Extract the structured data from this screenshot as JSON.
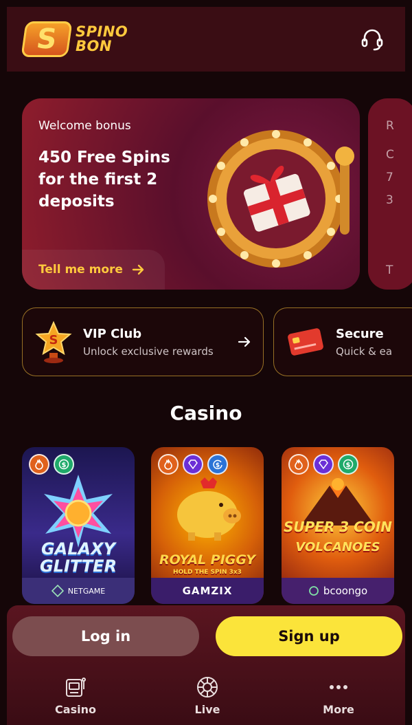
{
  "header": {
    "logo_mark": "S",
    "logo_text_line1": "SPINO",
    "logo_text_line2": "BON",
    "support_icon": "headset-icon"
  },
  "promo": {
    "eyebrow": "Welcome bonus",
    "headline": "450 Free Spins for the first 2 deposits",
    "cta_label": "Tell me more",
    "peek_letters": [
      "R",
      "C",
      "7",
      "3",
      "T"
    ]
  },
  "features": [
    {
      "title": "VIP Club",
      "subtitle": "Unlock exclusive rewards",
      "icon": "vip-trophy-icon"
    },
    {
      "title": "Secure",
      "subtitle": "Quick & ea",
      "icon": "credit-card-icon"
    }
  ],
  "casino": {
    "title": "Casino",
    "games": [
      {
        "title_line1": "GALAXY",
        "title_line2": "GLITTER",
        "provider": "NETGAME",
        "badges": [
          "fire",
          "cash"
        ]
      },
      {
        "title_line1": "ROYAL PIGGY",
        "title_line2": "HOLD THE SPIN 3x3",
        "provider": "GAMZIX",
        "badges": [
          "fire",
          "gem",
          "spin"
        ]
      },
      {
        "title_line1": "SUPER 3 COIN",
        "title_line2": "VOLCANOES",
        "provider": "bcoongo",
        "badges": [
          "fire",
          "gem",
          "cash"
        ]
      }
    ]
  },
  "auth": {
    "login_label": "Log in",
    "signup_label": "Sign up"
  },
  "nav": {
    "casino": "Casino",
    "live": "Live",
    "more": "More"
  },
  "colors": {
    "accent_yellow": "#fbe43a",
    "gold": "#ffc93d",
    "background": "#150608"
  }
}
